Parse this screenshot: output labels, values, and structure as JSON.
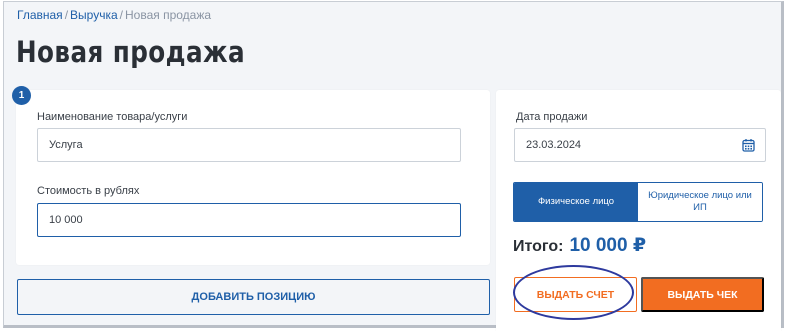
{
  "breadcrumb": {
    "items": [
      "Главная",
      "Выручка"
    ],
    "separator": "/",
    "current": "Новая продажа"
  },
  "page_title": "Новая продажа",
  "position_card": {
    "step_number": "1",
    "name_label": "Наименование товара/услуги",
    "name_value": "Услуга",
    "price_label": "Стоимость в рублях",
    "price_value": "10 000"
  },
  "add_position_button": "ДОБАВИТЬ ПОЗИЦИЮ",
  "sale_card": {
    "date_label": "Дата продажи",
    "date_value": "23.03.2024",
    "calendar_icon": "calendar-icon",
    "client_types": [
      {
        "label": "Физическое лицо",
        "selected": true
      },
      {
        "label": "Юридическое лицо или ИП",
        "selected": false
      }
    ],
    "total_label": "Итого:",
    "total_value": "10 000 ₽",
    "invoice_button": "ВЫДАТЬ СЧЕТ",
    "receipt_button": "ВЫДАТЬ ЧЕК"
  },
  "colors": {
    "accent_blue": "#1f5fa8",
    "accent_orange": "#f26d21",
    "background": "#f3f5f8",
    "annotation_ring": "#2e3a9e"
  }
}
